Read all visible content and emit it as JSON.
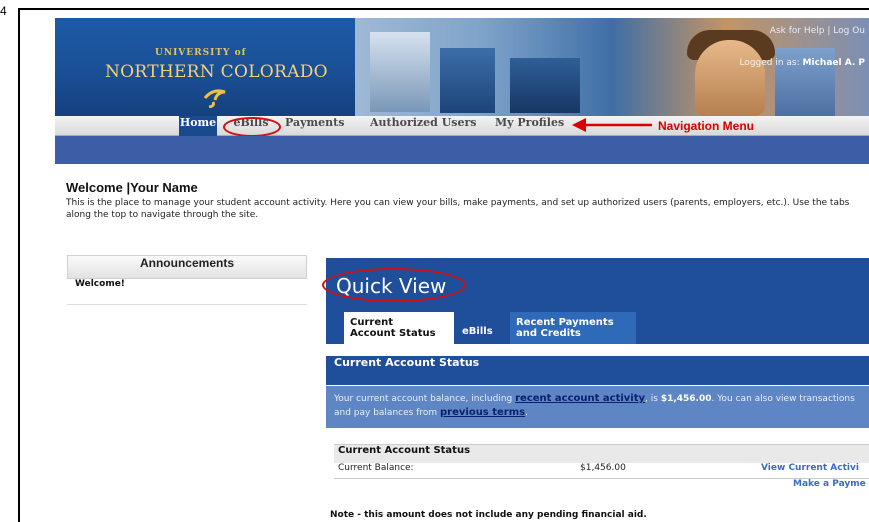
{
  "page_number": "4",
  "header": {
    "brand_top": "UNIVERSITY of",
    "brand_main": "NORTHERN COLORADO",
    "help_link": "Ask for Help",
    "separator": "|",
    "logout_link": "Log Ou",
    "logged_in_prefix": "Logged in as:",
    "logged_in_user": "Michael A. P"
  },
  "nav": {
    "items": [
      "Home",
      "eBills",
      "Payments",
      "Authorized Users",
      "My Profiles"
    ],
    "annotation": "Navigation Menu"
  },
  "welcome": {
    "title": "Welcome",
    "title_sep": "|",
    "name": "Your Name",
    "text": "This is the place to manage your student account activity. Here you can view your bills, make payments, and set up authorized users (parents, employers, etc.). Use the tabs along the top to navigate through the site."
  },
  "announcements": {
    "title": "Announcements",
    "item": "Welcome!"
  },
  "quick_view": {
    "title": "Quick View",
    "tabs": [
      {
        "line1": "Current",
        "line2": "Account Status"
      },
      {
        "line1": "eBills",
        "line2": ""
      },
      {
        "line1": "Recent Payments",
        "line2": "and Credits"
      }
    ],
    "section_title": "Current Account Status",
    "text_1": "Your current account balance, including ",
    "link_activity": "recent account activity",
    "text_2": ", is ",
    "balance_bold": "$1,456.00",
    "text_3": ". You can also view transactions and pay balances from ",
    "link_terms": "previous terms",
    "text_4": ".",
    "table": {
      "header": "Current Account Status",
      "row_label": "Current Balance:",
      "row_amount": "$1,456.00",
      "link_view": "View Current Activi",
      "link_pay": "Make a Payme"
    },
    "note": "Note - this amount does not include any pending financial aid."
  },
  "colors": {
    "header_blue": "#16418a",
    "band_blue": "#3b5ea6",
    "annotation_red": "#d80000",
    "link_blue": "#3a6cc4"
  }
}
